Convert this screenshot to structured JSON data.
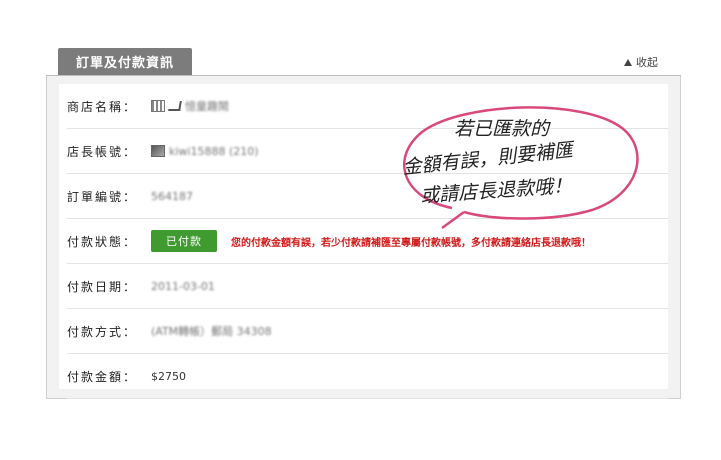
{
  "panel": {
    "tab_title": "訂單及付款資訊",
    "collapse_label": "收起"
  },
  "fields": {
    "store_name": {
      "label": "商店名稱：",
      "value": "憶童趣鬧"
    },
    "owner_account": {
      "label": "店長帳號：",
      "value": "kiwi15888 (210)"
    },
    "order_number": {
      "label": "訂單編號：",
      "value": "564187"
    },
    "payment_status": {
      "label": "付款狀態：",
      "button": "已付款",
      "warning": "您的付款金額有誤，若少付款請補匯至專屬付款帳號，多付款請連絡店長退款哦！"
    },
    "payment_date": {
      "label": "付款日期：",
      "value": "2011-03-01"
    },
    "payment_method": {
      "label": "付款方式：",
      "value": "(ATM轉帳）郵局 34308"
    },
    "payment_amount": {
      "label": "付款金額：",
      "value": "$2750"
    }
  },
  "callout": {
    "line1": "若已匯款的",
    "line2": "金額有誤，則要補匯",
    "line3": "或請店長退款哦！"
  },
  "colors": {
    "tab_bg": "#7c7c7c",
    "paid_green": "#3f9a30",
    "warning_red": "#d21b1b",
    "callout_pink": "#d94a7a"
  }
}
